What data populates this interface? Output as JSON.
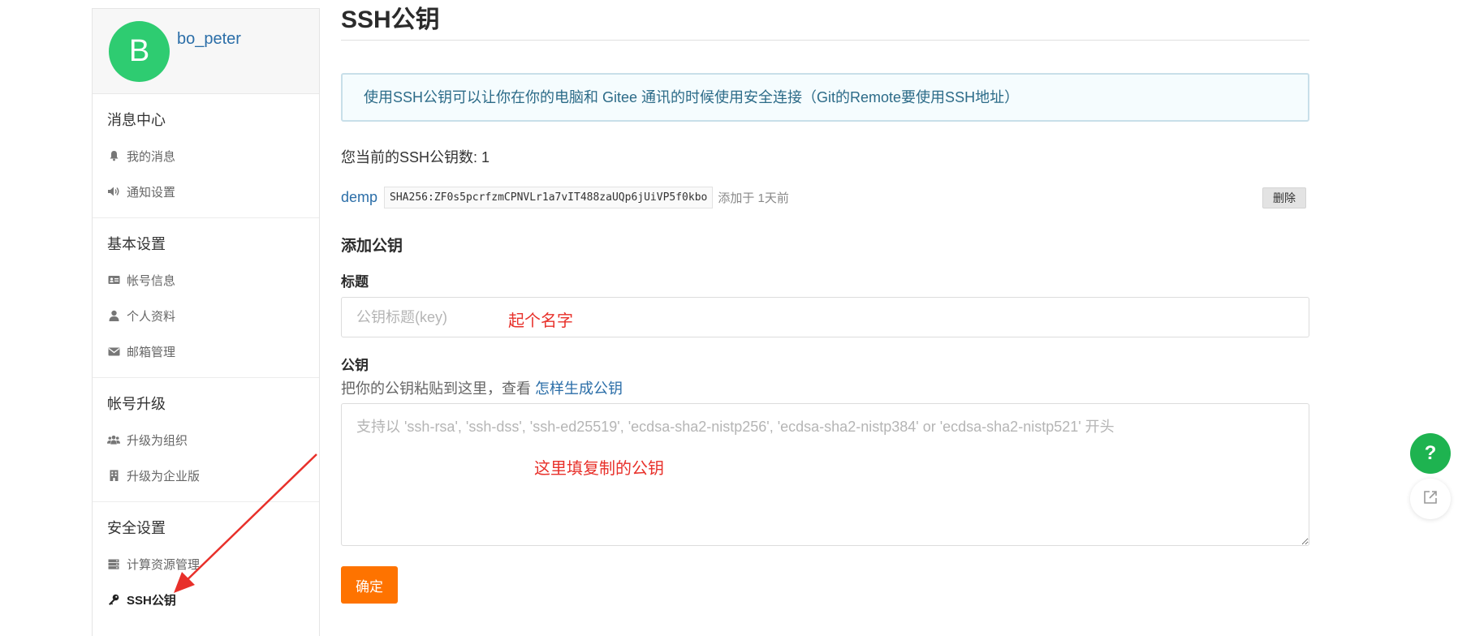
{
  "user": {
    "avatar_letter": "B",
    "name": "bo_peter"
  },
  "sidebar": {
    "sections": [
      {
        "title": "消息中心",
        "items": [
          {
            "label": "我的消息"
          },
          {
            "label": "通知设置"
          }
        ]
      },
      {
        "title": "基本设置",
        "items": [
          {
            "label": "帐号信息"
          },
          {
            "label": "个人资料"
          },
          {
            "label": "邮箱管理"
          }
        ]
      },
      {
        "title": "帐号升级",
        "items": [
          {
            "label": "升级为组织"
          },
          {
            "label": "升级为企业版"
          }
        ]
      },
      {
        "title": "安全设置",
        "items": [
          {
            "label": "计算资源管理"
          },
          {
            "label": "SSH公钥"
          }
        ]
      }
    ]
  },
  "main": {
    "title": "SSH公钥",
    "info": "使用SSH公钥可以让你在你的电脑和 Gitee 通讯的时候使用安全连接（Git的Remote要使用SSH地址）",
    "count_text": "您当前的SSH公钥数: 1",
    "key": {
      "name": "demp",
      "fingerprint": "SHA256:ZF0s5pcrfzmCPNVLr1a7vIT488zaUQp6jUiVP5f0kbo",
      "added": "添加于 1天前",
      "delete_label": "删除"
    },
    "add_title": "添加公钥",
    "title_label": "标题",
    "title_placeholder": "公钥标题(key)",
    "title_annotation": "起个名字",
    "pubkey_label": "公钥",
    "hint_text": "把你的公钥粘贴到这里，查看 ",
    "hint_link": "怎样生成公钥",
    "pubkey_placeholder": "支持以 'ssh-rsa', 'ssh-dss', 'ssh-ed25519', 'ecdsa-sha2-nistp256', 'ecdsa-sha2-nistp384' or 'ecdsa-sha2-nistp521' 开头",
    "pubkey_annotation": "这里填复制的公钥",
    "confirm_label": "确定"
  },
  "floating": {
    "help_label": "?"
  },
  "colors": {
    "accent": "#fe7300",
    "link": "#2b6ea8",
    "avatar": "#2ecc71",
    "help": "#1eb350",
    "annotation": "#e8302a"
  }
}
